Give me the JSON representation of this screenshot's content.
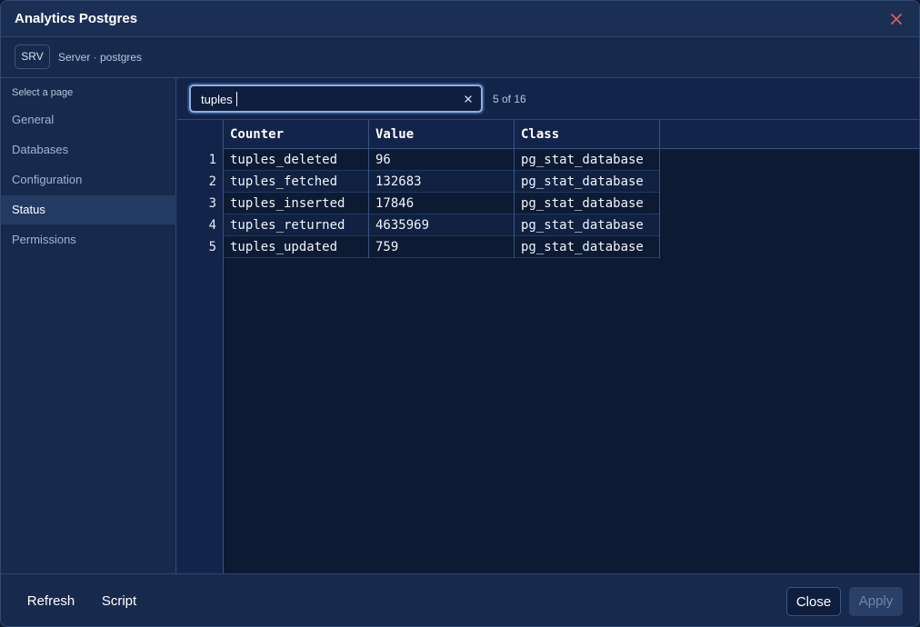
{
  "window": {
    "title": "Analytics Postgres"
  },
  "breadcrumb": {
    "badge": "SRV",
    "text": "Server · postgres"
  },
  "sidebar": {
    "heading": "Select a page",
    "items": [
      {
        "label": "General"
      },
      {
        "label": "Databases"
      },
      {
        "label": "Configuration"
      },
      {
        "label": "Status"
      },
      {
        "label": "Permissions"
      }
    ],
    "active": "Status"
  },
  "search": {
    "value": "tuples",
    "match_count": "5 of 16"
  },
  "table": {
    "columns": [
      "Counter",
      "Value",
      "Class"
    ],
    "rows": [
      {
        "num": "1",
        "counter": "tuples_deleted",
        "value": "96",
        "class": "pg_stat_database"
      },
      {
        "num": "2",
        "counter": "tuples_fetched",
        "value": "132683",
        "class": "pg_stat_database"
      },
      {
        "num": "3",
        "counter": "tuples_inserted",
        "value": "17846",
        "class": "pg_stat_database"
      },
      {
        "num": "4",
        "counter": "tuples_returned",
        "value": "4635969",
        "class": "pg_stat_database"
      },
      {
        "num": "5",
        "counter": "tuples_updated",
        "value": "759",
        "class": "pg_stat_database"
      }
    ]
  },
  "footer": {
    "refresh_label": "Refresh",
    "script_label": "Script",
    "close_label": "Close",
    "apply_label": "Apply"
  },
  "colors": {
    "background": "#0d1a33",
    "panel": "#172a4d",
    "accent": "#8fb0df",
    "close_icon": "#e05a5a"
  }
}
